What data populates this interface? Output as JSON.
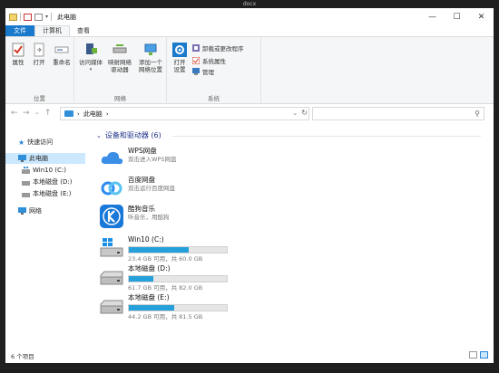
{
  "screen": {
    "top_caption": "docx"
  },
  "window": {
    "title": "此电脑",
    "controls": {
      "minimize": "—",
      "maximize": "☐",
      "close": "✕"
    }
  },
  "ribbon": {
    "tabs": [
      {
        "label": "文件"
      },
      {
        "label": "计算机"
      },
      {
        "label": "查看"
      }
    ],
    "groups": {
      "location": {
        "label": "位置",
        "buttons": {
          "properties": "属性",
          "open": "打开",
          "rename": "重命名"
        }
      },
      "network": {
        "label": "网络",
        "buttons": {
          "access_media": "访问媒体",
          "map_drive": "映射网络\n驱动器",
          "add_location": "添加一个\n网络位置"
        }
      },
      "system": {
        "label": "系统",
        "buttons": {
          "open_settings": "打开\n设置",
          "uninstall": "卸载或更改程序",
          "system_properties": "系统属性",
          "manage": "管理"
        }
      }
    }
  },
  "navigation": {
    "back": "←",
    "forward": "→",
    "recent": "⌄",
    "up": "↑",
    "path_separator": "›",
    "path": "此电脑",
    "path_trailing": "›",
    "address_dropdown": "⌄",
    "refresh": "↻",
    "search_placeholder": "",
    "search_glyph": "⚲"
  },
  "sidebar": {
    "quick_access": "快速访问",
    "this_pc": "此电脑",
    "drives": [
      {
        "label": "Win10 (C:)"
      },
      {
        "label": "本地磁盘 (D:)"
      },
      {
        "label": "本地磁盘 (E:)"
      }
    ],
    "network": "网络"
  },
  "main": {
    "section_title": "设备和驱动器 (6)",
    "apps": [
      {
        "name": "WPS网盘",
        "sub": "双击进入WPS网盘"
      },
      {
        "name": "百度网盘",
        "sub": "双击运行百度网盘"
      },
      {
        "name": "酷狗音乐",
        "sub": "听音乐，用酷狗"
      }
    ],
    "drives": [
      {
        "name": "Win10 (C:)",
        "free": "23.4 GB 可用，共 60.0 GB",
        "used_fraction": 0.61,
        "bar_color": "#26a0da"
      },
      {
        "name": "本地磁盘 (D:)",
        "free": "61.7 GB 可用，共 82.0 GB",
        "used_fraction": 0.25,
        "bar_color": "#26a0da"
      },
      {
        "name": "本地磁盘 (E:)",
        "free": "44.2 GB 可用，共 81.5 GB",
        "used_fraction": 0.46,
        "bar_color": "#26a0da"
      }
    ]
  },
  "status": {
    "items_count": "6 个项目"
  },
  "colors": {
    "accent": "#1979ca",
    "selection": "#cce8ff",
    "section_title": "#1e3287"
  }
}
